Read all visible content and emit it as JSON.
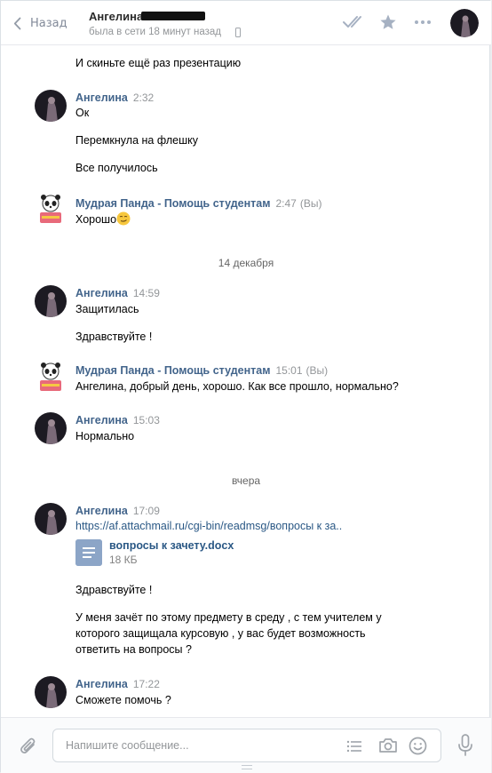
{
  "header": {
    "back_label": "Назад",
    "contact_name": "Ангелина",
    "status": "была в сети 18 минут назад"
  },
  "messages": {
    "m0": {
      "text": "И скиньте ещё раз презентацию"
    },
    "g1": {
      "author": "Ангелина",
      "time": "2:32",
      "lines": [
        "Ок",
        "Перемкнула на флешку",
        "Все получилось"
      ]
    },
    "g2": {
      "author": "Мудрая Панда - Помощь студентам",
      "time": "2:47",
      "you": "(Вы)",
      "text": "Хорошо"
    },
    "date1": "14 декабря",
    "g3": {
      "author": "Ангелина",
      "time": "14:59",
      "lines": [
        "Защитилась",
        "Здравствуйте !"
      ]
    },
    "g4": {
      "author": "Мудрая Панда - Помощь студентам",
      "time": "15:01",
      "you": "(Вы)",
      "text": "Ангелина, добрый день, хорошо. Как все прошло, нормально?"
    },
    "g5": {
      "author": "Ангелина",
      "time": "15:03",
      "text": "Нормально"
    },
    "date2": "вчера",
    "g6": {
      "author": "Ангелина",
      "time": "17:09",
      "link": "https://af.attachmail.ru/cgi-bin/readmsg/вопросы к за..",
      "doc_name": "вопросы к зачету.docx",
      "doc_size": "18 КБ",
      "greeting": "Здравствуйте !",
      "body_lines": [
        "У меня зачёт по этому предмету в среду , с тем учителем у",
        "которого защищала курсовую , у вас будет возможность",
        "ответить на вопросы ?"
      ]
    },
    "g7": {
      "author": "Ангелина",
      "time": "17:22",
      "text": "Сможете помочь ?"
    }
  },
  "composer": {
    "placeholder": "Напишите сообщение..."
  },
  "colors": {
    "link_blue": "#2a5885",
    "author_blue": "#42648b",
    "icon_gray": "#a0a5ab",
    "doc_blue": "#8ca5c7"
  },
  "icons": [
    "chevron-left-icon",
    "phone-icon",
    "double-check-icon",
    "star-icon",
    "more-icon",
    "paperclip-icon",
    "list-icon",
    "camera-icon",
    "smile-icon",
    "microphone-icon",
    "document-icon",
    "smirk-emoji-icon"
  ]
}
